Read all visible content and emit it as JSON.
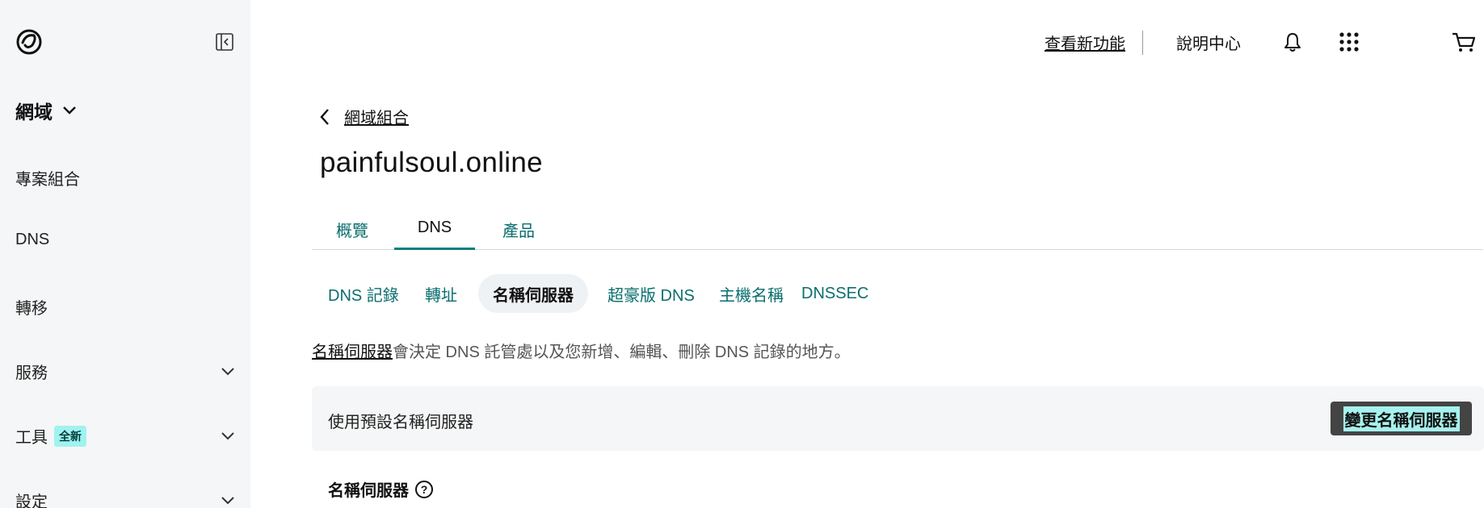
{
  "sidebar": {
    "heading": "網域",
    "items": [
      {
        "label": "專案組合",
        "has_chevron": false
      },
      {
        "label": "DNS",
        "has_chevron": false
      },
      {
        "label": "轉移",
        "has_chevron": false
      },
      {
        "label": "服務",
        "has_chevron": true
      },
      {
        "label": "工具",
        "has_chevron": true,
        "badge": "全新"
      },
      {
        "label": "設定",
        "has_chevron": true
      }
    ]
  },
  "header": {
    "whats_new": "查看新功能",
    "help_center": "說明中心",
    "icons": [
      "bell-icon",
      "apps-grid-icon",
      "cart-icon"
    ]
  },
  "breadcrumb": {
    "back_label": "網域組合"
  },
  "page_title": "painfulsoul.online",
  "tabs": [
    {
      "label": "概覽",
      "active": false
    },
    {
      "label": "DNS",
      "active": true
    },
    {
      "label": "產品",
      "active": false
    }
  ],
  "subtabs": [
    {
      "label": "DNS 記錄",
      "active": false
    },
    {
      "label": "轉址",
      "active": false
    },
    {
      "label": "名稱伺服器",
      "active": true
    },
    {
      "label": "超豪版 DNS",
      "active": false
    },
    {
      "label": "主機名稱",
      "active": false
    },
    {
      "label": "DNSSEC",
      "active": false
    }
  ],
  "description": {
    "link": "名稱伺服器",
    "text": "會決定 DNS 託管處以及您新增、編輯、刪除 DNS 記錄的地方。"
  },
  "panel": {
    "label": "使用預設名稱伺服器",
    "button": "變更名稱伺服器"
  },
  "section_heading": "名稱伺服器",
  "colors": {
    "accent": "#0a7f7f",
    "sidebar_bg": "#f5f6f7",
    "button_bg": "#444444",
    "highlight": "#a6f2ee"
  }
}
